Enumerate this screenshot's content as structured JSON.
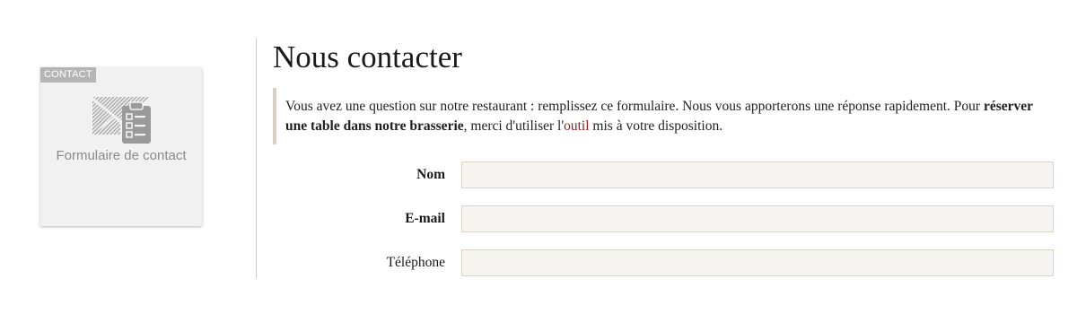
{
  "card": {
    "tag": "CONTACT",
    "label": "Formulaire de contact",
    "icon": "contact-form-icon"
  },
  "main": {
    "title": "Nous contacter",
    "intro": {
      "text_before": "Vous avez une question sur notre restaurant : remplissez ce formulaire. Nous vous apporterons une réponse rapidement. Pour ",
      "bold": "réserver une table dans notre brasserie",
      "text_middle": ", merci d'utiliser l'",
      "link": "outil",
      "text_after": " mis à votre disposition."
    }
  },
  "form": {
    "fields": [
      {
        "label": "Nom",
        "value": "",
        "placeholder": ""
      },
      {
        "label": "E-mail",
        "value": "",
        "placeholder": ""
      },
      {
        "label": "Téléphone",
        "value": "",
        "placeholder": ""
      }
    ]
  },
  "colors": {
    "link": "#8a2525",
    "input_background": "#f5f4f0",
    "input_border": "#d9d5c2",
    "quote_border": "#d8d0c2",
    "card_background": "#f1f1f1",
    "tag_background": "#b5b5b5"
  }
}
